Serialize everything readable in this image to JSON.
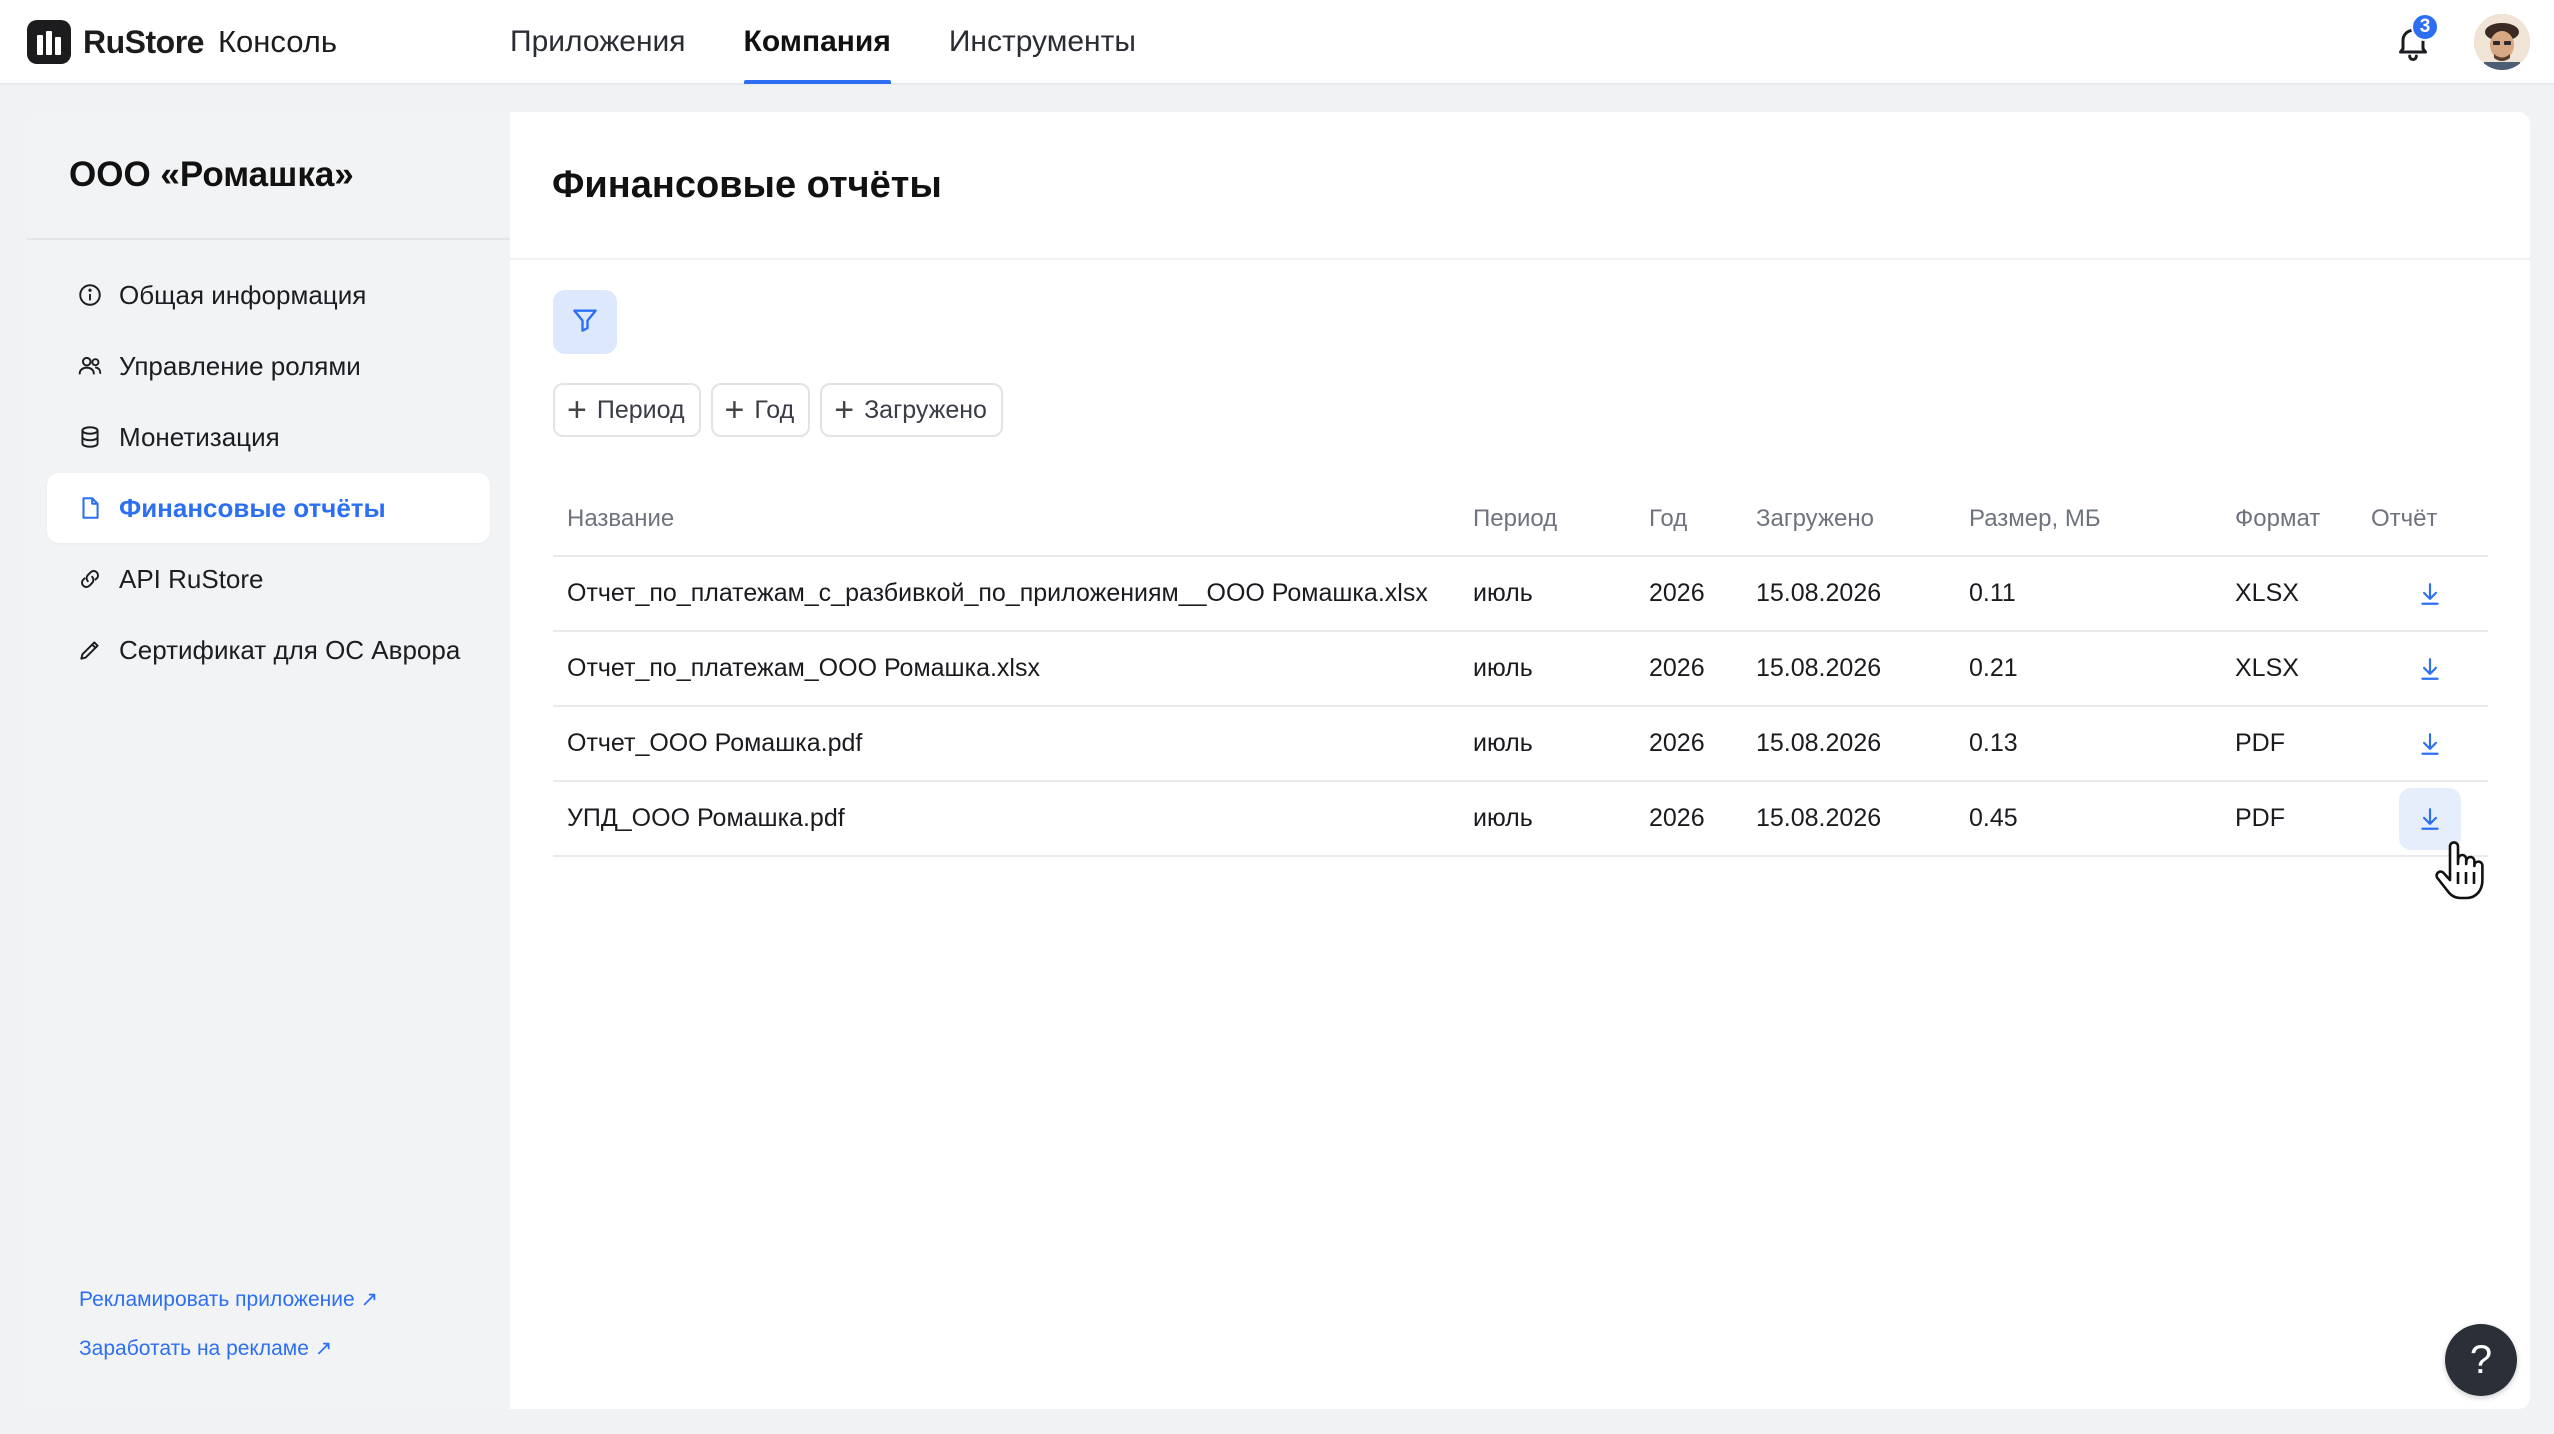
{
  "brand": {
    "name": "RuStore",
    "product": "Консоль"
  },
  "topnav": [
    {
      "label": "Приложения",
      "active": false
    },
    {
      "label": "Компания",
      "active": true
    },
    {
      "label": "Инструменты",
      "active": false
    }
  ],
  "notifications": {
    "count": "3",
    "icon": "bell-icon"
  },
  "colors": {
    "accent": "#2d6ff3",
    "text": "#1a1b1f",
    "muted": "#6f737d",
    "sidebar_bg": "#f2f3f5"
  },
  "sidebar": {
    "company": "ООО «Ромашка»",
    "items": [
      {
        "label": "Общая информация",
        "icon": "info-icon"
      },
      {
        "label": "Управление ролями",
        "icon": "users-icon"
      },
      {
        "label": "Монетизация",
        "icon": "database-icon"
      },
      {
        "label": "Финансовые отчёты",
        "icon": "document-icon",
        "active": true
      },
      {
        "label": "API RuStore",
        "icon": "link-icon"
      },
      {
        "label": "Сертификат для ОС Аврора",
        "icon": "pen-icon"
      }
    ],
    "links": [
      {
        "label": "Рекламировать приложение ↗"
      },
      {
        "label": "Заработать на рекламе ↗"
      }
    ]
  },
  "main": {
    "title": "Финансовые отчёты",
    "filter_icon": "filter-icon",
    "chips": [
      {
        "label": "Период"
      },
      {
        "label": "Год"
      },
      {
        "label": "Загружено"
      }
    ],
    "table": {
      "columns": [
        "Название",
        "Период",
        "Год",
        "Загружено",
        "Размер, МБ",
        "Формат",
        "Отчёт"
      ],
      "rows": [
        {
          "name": "Отчет_по_платежам_с_разбивкой_по_приложениям__ООО Ромашка.xlsx",
          "period": "июль",
          "year": "2026",
          "uploaded": "15.08.2026",
          "size": "0.11",
          "format": "XLSX"
        },
        {
          "name": "Отчет_по_платежам_ООО Ромашка.xlsx",
          "period": "июль",
          "year": "2026",
          "uploaded": "15.08.2026",
          "size": "0.21",
          "format": "XLSX"
        },
        {
          "name": "Отчет_ООО Ромашка.pdf",
          "period": "июль",
          "year": "2026",
          "uploaded": "15.08.2026",
          "size": "0.13",
          "format": "PDF"
        },
        {
          "name": "УПД_ООО Ромашка.pdf",
          "period": "июль",
          "year": "2026",
          "uploaded": "15.08.2026",
          "size": "0.45",
          "format": "PDF"
        }
      ]
    }
  },
  "help": {
    "label": "?"
  }
}
